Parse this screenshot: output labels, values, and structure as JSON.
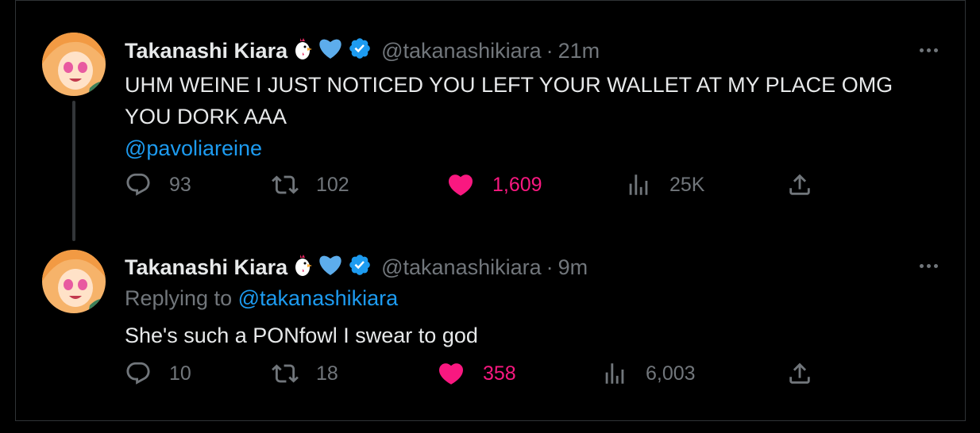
{
  "tweets": [
    {
      "name": "Takanashi Kiara",
      "name_emoji": "chicken-emoji",
      "badge": "blue-heart-emoji",
      "verified": "verified-badge-icon",
      "handle": "@takanashikiara",
      "time": "21m",
      "text": "UHM WEINE I JUST NOTICED YOU LEFT YOUR WALLET AT MY PLACE OMG YOU DORK AAA",
      "mention": "@pavoliareine",
      "replies": "93",
      "retweets": "102",
      "likes": "1,609",
      "views": "25K",
      "liked": true
    },
    {
      "name": "Takanashi Kiara",
      "name_emoji": "chicken-emoji",
      "badge": "blue-heart-emoji",
      "verified": "verified-badge-icon",
      "handle": "@takanashikiara",
      "time": "9m",
      "replying_prefix": "Replying to",
      "replying_to": "@takanashikiara",
      "text": "She's such a PONfowl I swear to god",
      "replies": "10",
      "retweets": "18",
      "likes": "358",
      "views": "6,003",
      "liked": true
    }
  ],
  "colors": {
    "background": "#000000",
    "text": "#e7e9ea",
    "muted": "#71767b",
    "link": "#1d9bf0",
    "like": "#f91880"
  }
}
